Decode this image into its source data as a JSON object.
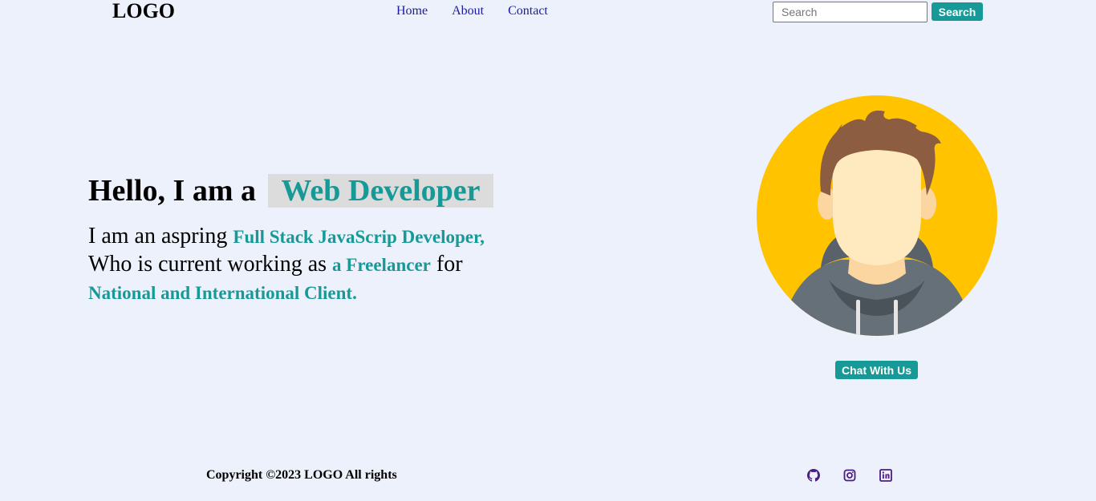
{
  "header": {
    "logo": "LOGO",
    "nav": [
      "Home",
      "About",
      "Contact"
    ],
    "search_placeholder": "Search",
    "search_button": "Search"
  },
  "hero": {
    "greeting": "Hello, I am a",
    "role": "Web Developer",
    "line1_prefix": "I am an aspring ",
    "line1_highlight": "Full Stack JavaScrip Developer,",
    "line2_prefix": "Who is current working as ",
    "line2_highlight": "a Freelancer",
    "line2_suffix": " for",
    "line3_highlight": "National and International Client."
  },
  "avatar": {
    "chat_button": "Chat With Us"
  },
  "footer": {
    "copyright": "Copyright ©2023 LOGO All rights",
    "social_icons": [
      "github-icon",
      "instagram-icon",
      "linkedin-icon"
    ]
  },
  "colors": {
    "background": "#edf1fc",
    "accent": "#179a97",
    "nav_link": "#1a1aa6",
    "avatar_bg": "#ffc300",
    "social_icon": "#4b1d82"
  }
}
